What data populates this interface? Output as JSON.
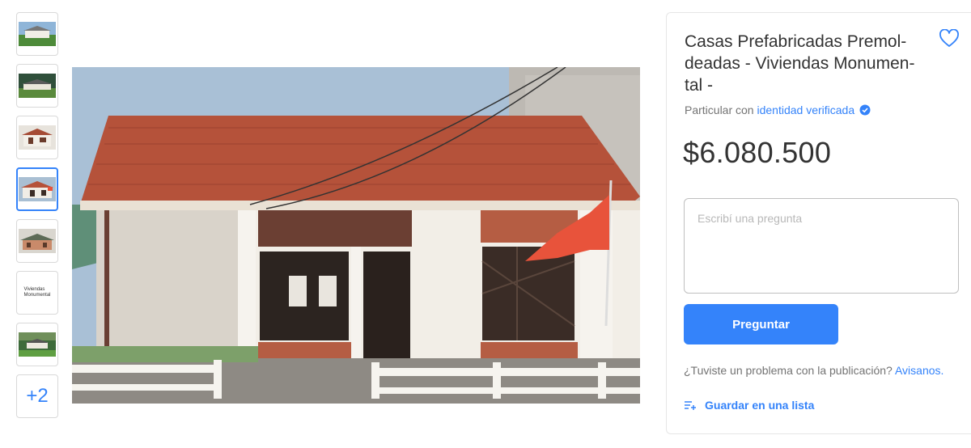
{
  "gallery": {
    "thumbnails": [
      {
        "icon": "house-photo-1"
      },
      {
        "icon": "house-photo-2"
      },
      {
        "icon": "house-photo-3"
      },
      {
        "icon": "house-photo-4",
        "active": true
      },
      {
        "icon": "house-photo-5"
      },
      {
        "icon": "logo-thumbnail",
        "logo_line1": "Viviendas",
        "logo_line2": "Monumental"
      },
      {
        "icon": "house-photo-7"
      }
    ],
    "more_label": "+2"
  },
  "listing": {
    "title": "Casas Prefabricadas Premol- deadas - Viviendas Monumen- tal -",
    "seller_prefix": "Particular con ",
    "seller_link": "identidad verificada",
    "price": "$6.080.500",
    "question_placeholder": "Escribí una pregunta",
    "ask_button": "Preguntar",
    "problem_text": "¿Tuviste un problema con la publicación? ",
    "problem_link": "Avisanos.",
    "save_list": "Guardar en una lista"
  },
  "colors": {
    "accent": "#3483fa",
    "roof": "#b5523a",
    "flag": "#e8533b"
  }
}
